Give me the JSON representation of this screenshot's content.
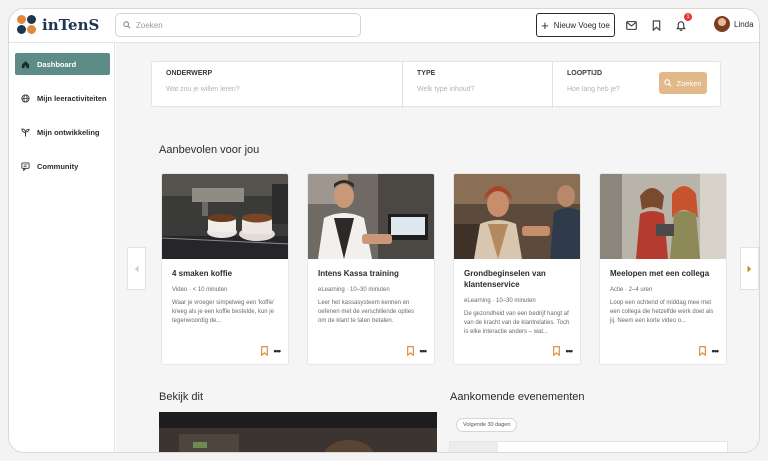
{
  "app": {
    "logo_text": "inTenS"
  },
  "topbar": {
    "search_placeholder": "Zoeken",
    "new_button_label": "Nieuw Voeg toe",
    "notification_count": "1",
    "user_name": "Linda"
  },
  "sidebar": {
    "items": [
      {
        "label": "Dashboard",
        "icon": "home-icon",
        "active": true
      },
      {
        "label": "Mijn leeractiviteiten",
        "icon": "globe-icon",
        "active": false
      },
      {
        "label": "Mijn ontwikkeling",
        "icon": "sprout-icon",
        "active": false
      },
      {
        "label": "Community",
        "icon": "chat-icon",
        "active": false
      }
    ]
  },
  "filter": {
    "onderwerp": {
      "label": "ONDERWERP",
      "placeholder": "Wat zou je willen leren?"
    },
    "type": {
      "label": "TYPE",
      "placeholder": "Welk type inhoud?"
    },
    "looptijd": {
      "label": "LOOPTIJD",
      "placeholder": "Hoe lang heb je?"
    },
    "search_button": "Zoeken"
  },
  "recommended": {
    "title": "Aanbevolen voor jou",
    "cards": [
      {
        "title": "4 smaken koffie",
        "meta": "Video · < 10 minuten",
        "description": "Waar je vroeger simpelweg een 'koffie' kreeg als je een koffie bestelde, kun je tegenwoordig de..."
      },
      {
        "title": "Intens Kassa training",
        "meta": "eLearning · 10–30 minuten",
        "description": "Leer het kassasysteem kennen en oefenen met de verschillende opties om de klant te laten betalen."
      },
      {
        "title": "Grondbeginselen van klantenservice",
        "meta": "eLearning · 10–30 minuten",
        "description": "De gezondheid van een bedrijf hangt af van de kracht van de klantrelaties. Toch is elke interactie anders – wat..."
      },
      {
        "title": "Meelopen met een collega",
        "meta": "Actie · 2–4 uren",
        "description": "Loop een ochtend of middag mee met een collega die hetzelfde werk doet als jij. Neem een korte video o..."
      }
    ]
  },
  "watch": {
    "title": "Bekijk dit"
  },
  "events": {
    "title": "Aankomende evenementen",
    "filter_chip": "Volgende 30 dagen"
  },
  "colors": {
    "accent": "#5d8c88",
    "button_orange": "#e3b98a",
    "brand_dark": "#1e3550"
  }
}
